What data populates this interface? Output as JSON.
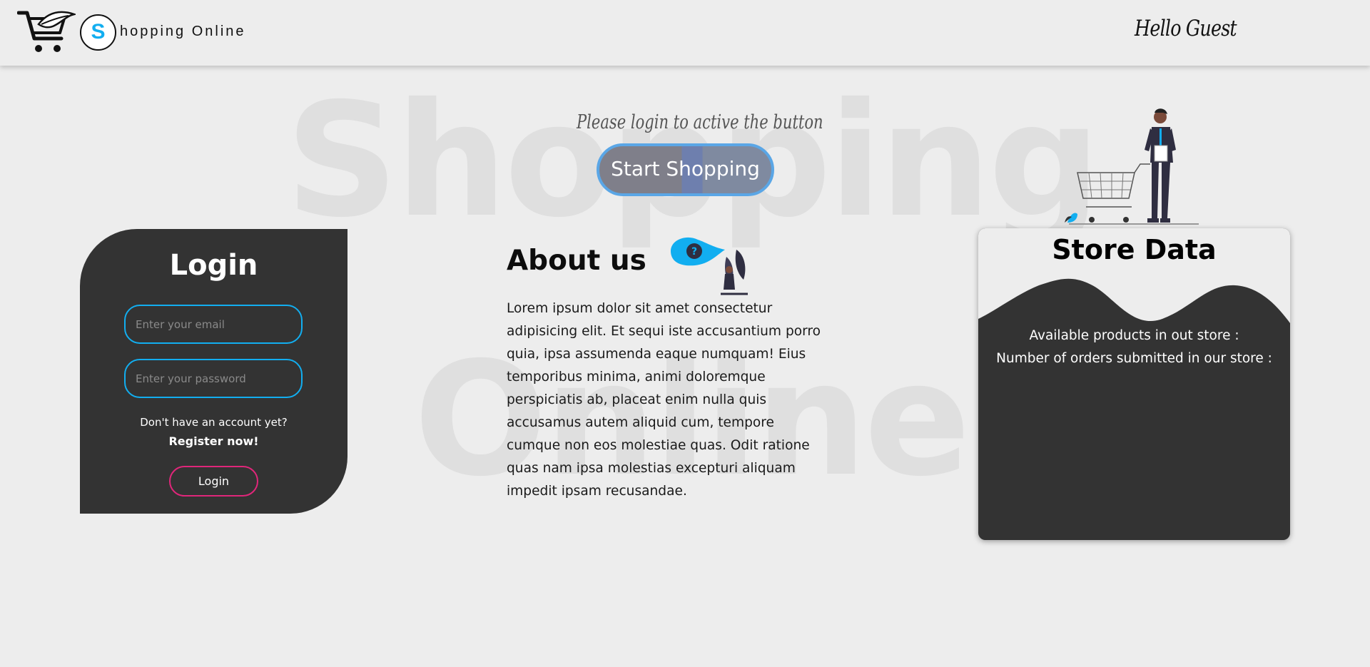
{
  "navbar": {
    "logo_letter": "S",
    "brand": "hopping Online",
    "greeting": "Hello Guest"
  },
  "hero": {
    "background_words": [
      "Shopping",
      "Online"
    ],
    "hint": "Please login to active the button",
    "start_button": "Start Shopping"
  },
  "login": {
    "title": "Login",
    "email_placeholder": "Enter your email",
    "password_placeholder": "Enter your password",
    "no_account": "Don't have an account yet?",
    "register_link": "Register now!",
    "button": "Login"
  },
  "about": {
    "title": "About us",
    "text": "Lorem ipsum dolor sit amet consectetur adipisicing elit. Et sequi iste accusantium porro quia, ipsa assumenda eaque numquam! Eius temporibus minima, animi doloremque perspiciatis ab, placeat enim nulla quis accusamus autem aliquid cum, tempore cumque non eos molestiae quas. Odit ratione quas nam ipsa molestias excepturi aliquam impedit ipsam recusandae."
  },
  "store": {
    "title": "Store Data",
    "products_label": "Available products in out store :",
    "orders_label": "Number of orders submitted in our store :"
  },
  "colors": {
    "accent": "#12aef0",
    "dark_panel": "#333333",
    "pink": "#e0267a",
    "background": "#ededed"
  },
  "icons": [
    "shopping-cart-logo-icon",
    "person-with-cart-illustration",
    "question-bubble-illustration"
  ]
}
